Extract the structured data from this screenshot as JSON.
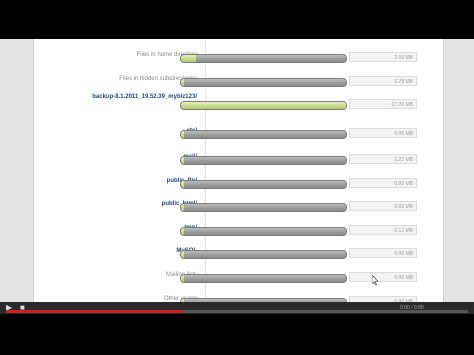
{
  "rows": [
    {
      "label": "Files in home directory",
      "style": "plain",
      "fill": 0.09,
      "size": "2.00 MB"
    },
    {
      "label": "Files in hidden subdirectories",
      "style": "plain",
      "fill": 0.02,
      "size": "0.78 MB"
    },
    {
      "label": "backup-8.1.2011_19.52.39_mybiz123/",
      "style": "link",
      "fill": 1.0,
      "size": "27.09 MB"
    },
    {
      "label": "etc/",
      "style": "link",
      "fill": 0.01,
      "size": "0.05 MB"
    },
    {
      "label": "mail/",
      "style": "link",
      "fill": 0.02,
      "size": "0.22 MB"
    },
    {
      "label": "public_ftp/",
      "style": "link",
      "fill": 0.0,
      "size": "0.00 MB"
    },
    {
      "label": "public_html/",
      "style": "link",
      "fill": 0.0,
      "size": "0.03 MB"
    },
    {
      "label": "tmp/",
      "style": "link",
      "fill": 0.02,
      "size": "0.12 MB"
    },
    {
      "label": "MySQL",
      "style": "link",
      "fill": 0.0,
      "size": "0.00 MB"
    },
    {
      "label": "Mailing lists",
      "style": "plain",
      "fill": 0.0,
      "size": "0.00 MB"
    },
    {
      "label": "Other usage",
      "style": "plain",
      "fill": 0.0,
      "size": "0.00 MB"
    }
  ],
  "player": {
    "progress": 0.38,
    "time_label": "0:00 / 0:00",
    "play_icon": "play-icon",
    "pause_icon": "stop-icon"
  },
  "colors": {
    "fill": "#c8d98a",
    "track": "#9a9a9a",
    "link": "#1f4a7a",
    "seek": "#d21d1d"
  }
}
